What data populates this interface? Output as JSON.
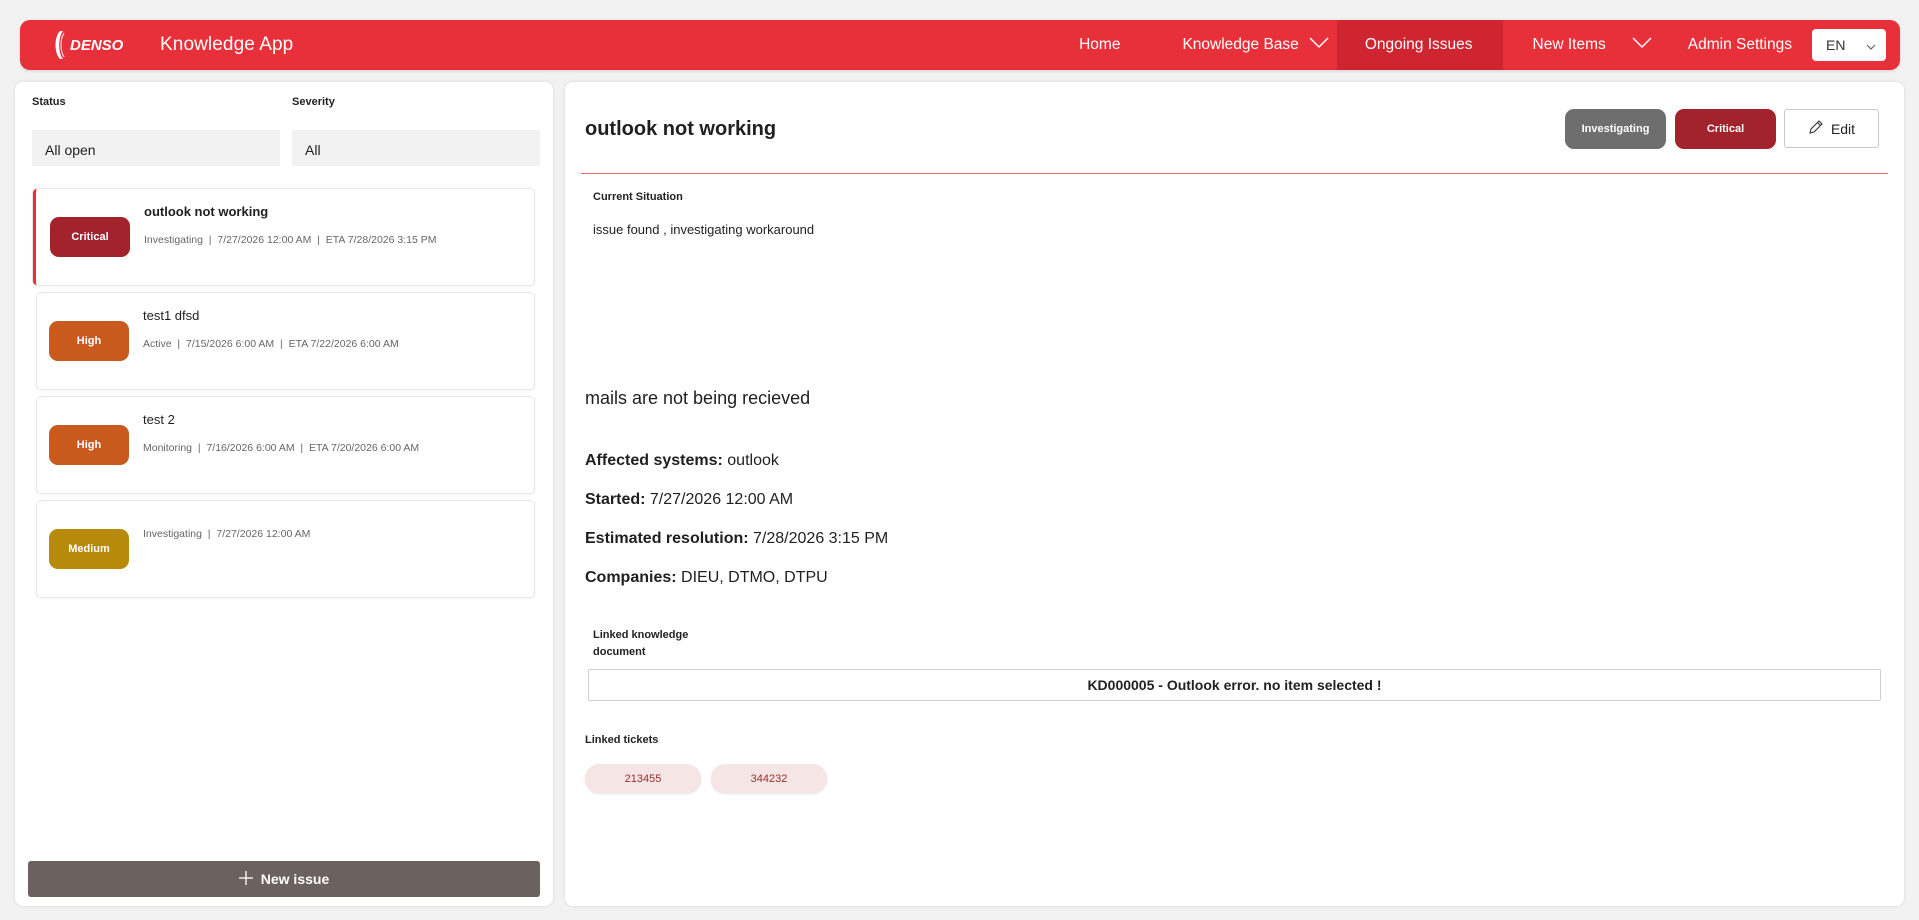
{
  "header": {
    "brand": "DENSO",
    "app_title": "Knowledge App",
    "nav": [
      {
        "label": "Home",
        "active": false,
        "dropdown": false
      },
      {
        "label": "Knowledge Base",
        "active": false,
        "dropdown": true
      },
      {
        "label": "Ongoing Issues",
        "active": true,
        "dropdown": false
      },
      {
        "label": "New Items",
        "active": false,
        "dropdown": true
      },
      {
        "label": "Admin Settings",
        "active": false,
        "dropdown": false
      }
    ],
    "language": "EN"
  },
  "filters": {
    "status_label": "Status",
    "status_value": "All open",
    "severity_label": "Severity",
    "severity_value": "All"
  },
  "issues": [
    {
      "title": "outlook not working",
      "severity": "Critical",
      "status": "Investigating",
      "started": "7/27/2026 12:00 AM",
      "eta": "ETA 7/28/2026 3:15 PM",
      "selected": true
    },
    {
      "title": "test1 dfsd",
      "severity": "High",
      "status": "Active",
      "started": "7/15/2026 6:00 AM",
      "eta": "ETA 7/22/2026 6:00 AM",
      "selected": false
    },
    {
      "title": "test 2",
      "severity": "High",
      "status": "Monitoring",
      "started": "7/16/2026 6:00 AM",
      "eta": "ETA 7/20/2026 6:00 AM",
      "selected": false
    },
    {
      "title": "",
      "severity": "Medium",
      "status": "Investigating",
      "started": "7/27/2026 12:00 AM",
      "eta": "",
      "selected": false
    }
  ],
  "new_issue_label": "New issue",
  "detail": {
    "title": "outlook not working",
    "status_pill": "Investigating",
    "severity_pill": "Critical",
    "edit_label": "Edit",
    "current_situation_label": "Current Situation",
    "current_situation": "issue found , investigating workaround",
    "description": "mails are not being recieved",
    "affected_label": "Affected systems:",
    "affected_value": "outlook",
    "started_label": "Started:",
    "started_value": "7/27/2026 12:00 AM",
    "eta_label": "Estimated resolution:",
    "eta_value": "7/28/2026 3:15 PM",
    "companies_label": "Companies:",
    "companies_value": "DIEU, DTMO, DTPU",
    "linked_doc_label_line1": "Linked knowledge",
    "linked_doc_label_line2": "document",
    "linked_doc": "KD000005 - Outlook error. no item selected !",
    "linked_tickets_label": "Linked tickets",
    "tickets": [
      "213455",
      "344232"
    ]
  },
  "colors": {
    "brand_red": "#e8303a",
    "nav_active": "#cf2530",
    "critical": "#a3232d",
    "high": "#c95a1e",
    "medium": "#b88a0a",
    "investigating": "#6e6e6e",
    "new_issue_button": "#6b615e"
  },
  "icons": {
    "dropdown": "chevron-down-icon",
    "add": "plus-icon",
    "edit": "pencil-icon"
  }
}
